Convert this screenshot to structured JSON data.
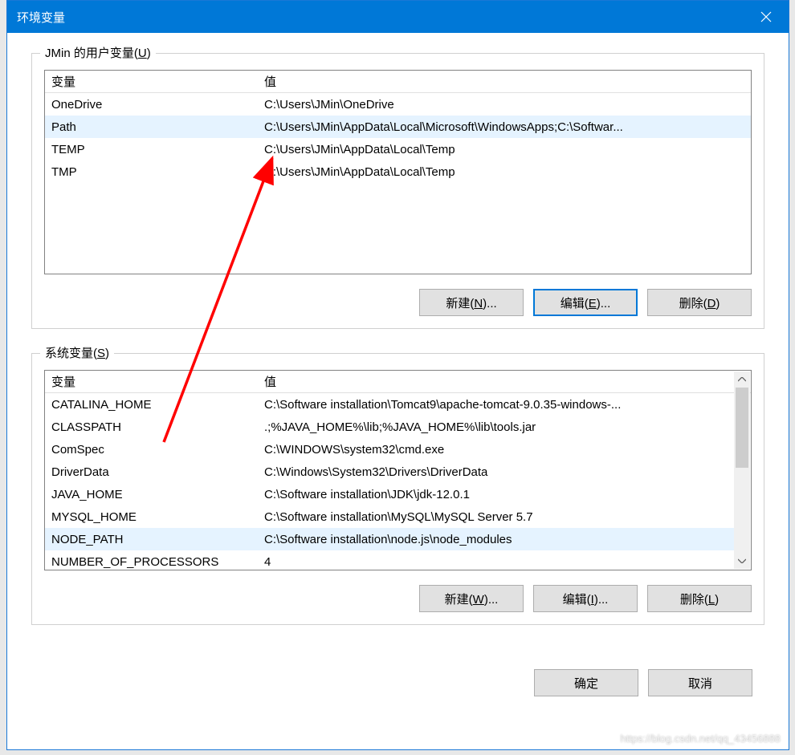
{
  "window": {
    "title": "环境变量"
  },
  "user_section": {
    "label": "JMin 的用户变量(U)",
    "headers": {
      "name": "变量",
      "value": "值"
    },
    "rows": [
      {
        "name": "OneDrive",
        "value": "C:\\Users\\JMin\\OneDrive",
        "selected": false
      },
      {
        "name": "Path",
        "value": "C:\\Users\\JMin\\AppData\\Local\\Microsoft\\WindowsApps;C:\\Softwar...",
        "selected": true
      },
      {
        "name": "TEMP",
        "value": "C:\\Users\\JMin\\AppData\\Local\\Temp",
        "selected": false
      },
      {
        "name": "TMP",
        "value": "C:\\Users\\JMin\\AppData\\Local\\Temp",
        "selected": false
      }
    ],
    "buttons": {
      "new": "新建(N)...",
      "edit": "编辑(E)...",
      "delete": "删除(D)"
    }
  },
  "system_section": {
    "label": "系统变量(S)",
    "headers": {
      "name": "变量",
      "value": "值"
    },
    "rows": [
      {
        "name": "CATALINA_HOME",
        "value": "C:\\Software installation\\Tomcat9\\apache-tomcat-9.0.35-windows-...",
        "selected": false
      },
      {
        "name": "CLASSPATH",
        "value": ".;%JAVA_HOME%\\lib;%JAVA_HOME%\\lib\\tools.jar",
        "selected": false
      },
      {
        "name": "ComSpec",
        "value": "C:\\WINDOWS\\system32\\cmd.exe",
        "selected": false
      },
      {
        "name": "DriverData",
        "value": "C:\\Windows\\System32\\Drivers\\DriverData",
        "selected": false
      },
      {
        "name": "JAVA_HOME",
        "value": "C:\\Software installation\\JDK\\jdk-12.0.1",
        "selected": false
      },
      {
        "name": "MYSQL_HOME",
        "value": "C:\\Software installation\\MySQL\\MySQL Server 5.7",
        "selected": false
      },
      {
        "name": "NODE_PATH",
        "value": "C:\\Software installation\\node.js\\node_modules",
        "selected": true
      },
      {
        "name": "NUMBER_OF_PROCESSORS",
        "value": "4",
        "selected": false
      }
    ],
    "buttons": {
      "new": "新建(W)...",
      "edit": "编辑(I)...",
      "delete": "删除(L)"
    }
  },
  "final": {
    "ok": "确定",
    "cancel": "取消"
  },
  "watermark": "https://blog.csdn.net/qq_43456888"
}
